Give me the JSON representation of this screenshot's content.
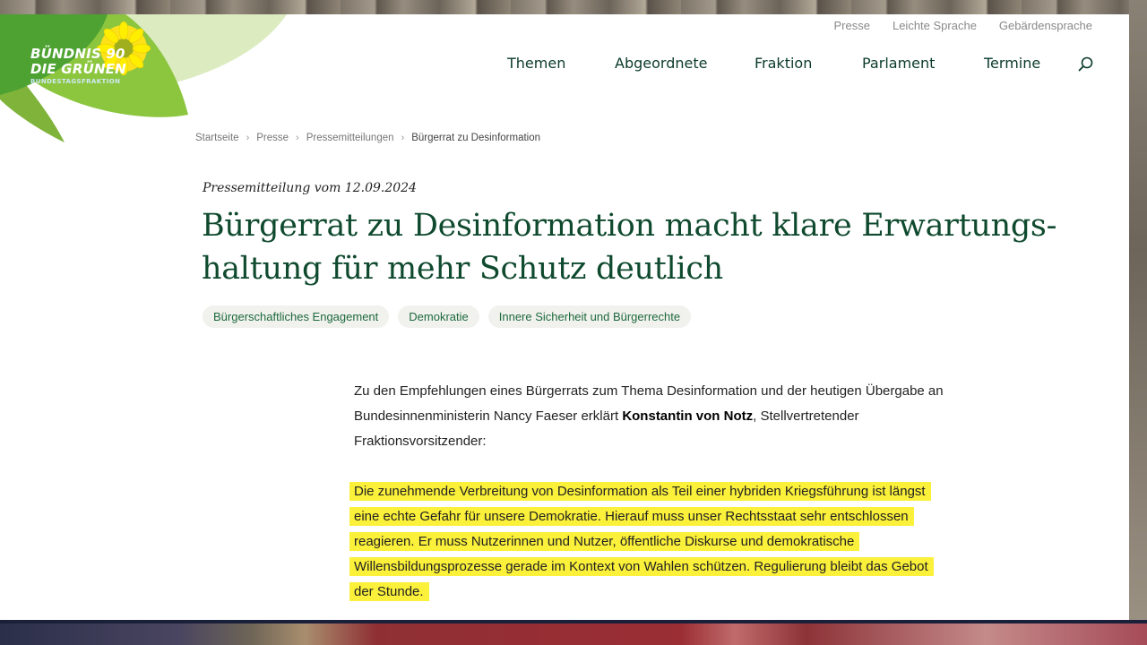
{
  "logo": {
    "line1": "BÜNDNIS 90",
    "line2": "DIE GRÜNEN",
    "line3": "BUNDESTAGSFRAKTION"
  },
  "service_nav": {
    "presse": "Presse",
    "leichte_sprache": "Leichte Sprache",
    "gebaerdensprache": "Gebärdensprache"
  },
  "main_nav": {
    "themen": "Themen",
    "abgeordnete": "Abgeordnete",
    "fraktion": "Fraktion",
    "parlament": "Parlament",
    "termine": "Termine",
    "search_icon": "search-icon"
  },
  "breadcrumb": {
    "items": [
      "Startseite",
      "Presse",
      "Pressemitteilungen",
      "Bürgerrat zu Desinformation"
    ],
    "separator": "›"
  },
  "article": {
    "kicker": "Pressemitteilung vom 12.09.2024",
    "headline": "Bürgerrat zu Desinformation macht klare Erwartungs­haltung für mehr Schutz deutlich",
    "tags": [
      "Bürgerschaftliches Engagement",
      "Demokratie",
      "Innere Sicherheit und Bürgerrechte"
    ],
    "lead_before": "Zu den Empfehlungen eines Bürgerrats zum Thema Desinformation und der heutigen Über­gabe an Bundesinnenministerin Nancy Faeser erklärt ",
    "lead_name": "Konstantin von Notz",
    "lead_after": ", Stellvertreten­der Fraktionsvorsitzender:",
    "quote": "Die zunehmende Verbreitung von Desinformation als Teil einer hybriden Kriegsführung ist längst eine echte Gefahr für unsere Demokratie. Hierauf muss unser Rechtsstaat sehr ent­schlossen reagieren. Er muss Nutzerinnen und Nutzer, öffentliche Diskurse und demokrati­sche Willensbildungsprozesse gerade im Kontext von Wahlen schützen. Regulierung bleibt das Gebot der Stunde."
  },
  "colors": {
    "brand_green": "#0f4a2e",
    "logo_green": "#8cc63f",
    "highlight": "#fbf03a",
    "tag_text": "#1d6a3c"
  }
}
